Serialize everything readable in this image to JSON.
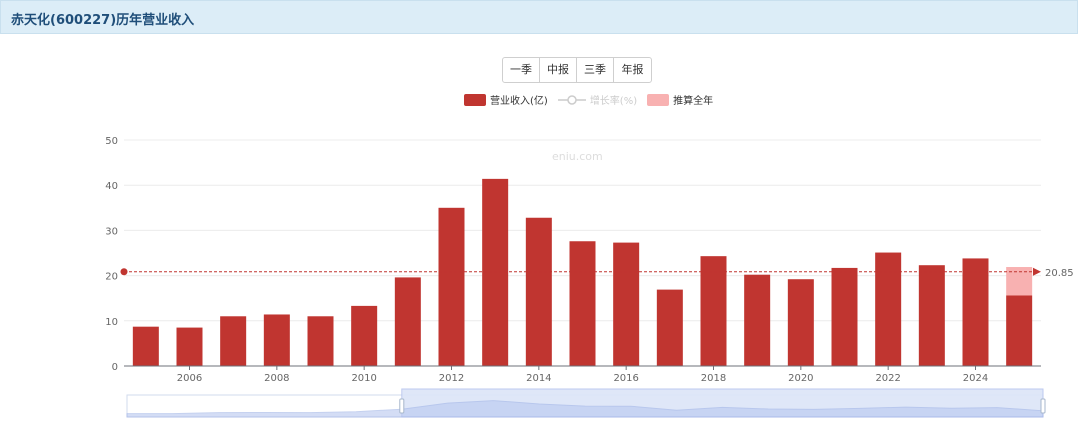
{
  "header": {
    "title": "赤天化(600227)历年营业收入"
  },
  "tabs": [
    {
      "label": "一季"
    },
    {
      "label": "中报"
    },
    {
      "label": "三季"
    },
    {
      "label": "年报"
    }
  ],
  "legend": {
    "revenue": "营业收入(亿)",
    "growth": "增长率(%)",
    "estimate": "推算全年"
  },
  "watermark": "eniu.com",
  "colors": {
    "bar": "#c03530",
    "estimate": "#f8b1b1",
    "ref_line": "#c03530",
    "growth_disabled": "#cccccc",
    "title_bg": "#dcedf7"
  },
  "chart_data": {
    "type": "bar",
    "title": "赤天化(600227)历年营业收入",
    "xlabel": "",
    "ylabel": "",
    "ylim": [
      0,
      50
    ],
    "yticks": [
      0,
      10,
      20,
      30,
      40,
      50
    ],
    "x_tick_labels": [
      "2006",
      "2008",
      "2010",
      "2012",
      "2014",
      "2016",
      "2018",
      "2020",
      "2022",
      "2024"
    ],
    "categories": [
      "2005",
      "2006",
      "2007",
      "2008",
      "2009",
      "2010",
      "2011",
      "2012",
      "2013",
      "2014",
      "2015",
      "2016",
      "2017",
      "2018",
      "2019",
      "2020",
      "2021",
      "2022",
      "2023",
      "2024",
      "2025"
    ],
    "series": [
      {
        "name": "营业收入(亿)",
        "values": [
          8.7,
          8.5,
          11.0,
          11.4,
          11.0,
          13.3,
          19.6,
          35.0,
          41.4,
          32.8,
          27.6,
          27.3,
          16.9,
          24.3,
          20.2,
          19.2,
          21.7,
          25.1,
          22.3,
          23.8,
          15.6
        ]
      },
      {
        "name": "推算全年",
        "values": [
          null,
          null,
          null,
          null,
          null,
          null,
          null,
          null,
          null,
          null,
          null,
          null,
          null,
          null,
          null,
          null,
          null,
          null,
          null,
          null,
          21.9
        ]
      }
    ],
    "reference_line": {
      "value": 20.85,
      "label": "20.85"
    },
    "legend_position": "top-center",
    "grid": true,
    "has_zoom_slider": true
  }
}
